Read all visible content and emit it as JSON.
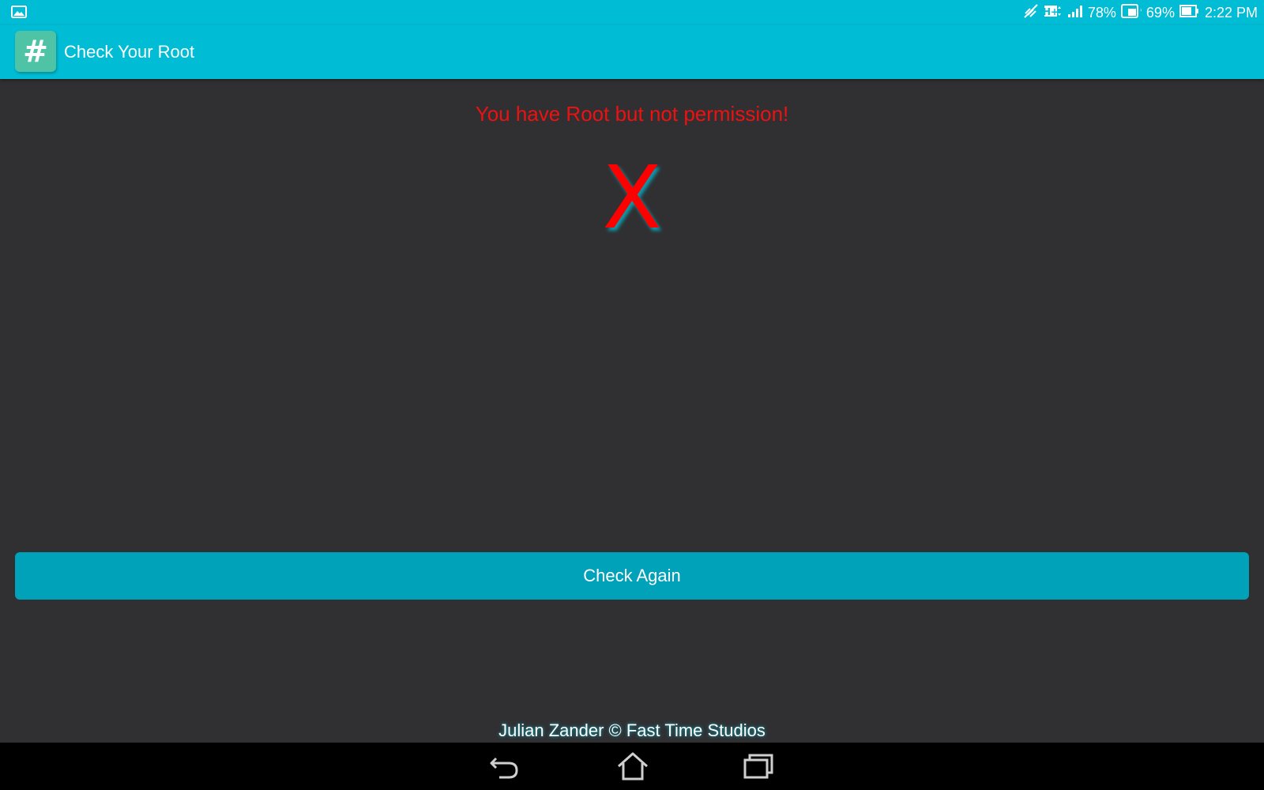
{
  "status_bar": {
    "left_icon": "gallery-notification-icon",
    "icons": [
      "mute-icon",
      "hplus-data-icon",
      "signal-icon",
      "tablet-battery-icon",
      "battery-icon"
    ],
    "signal_percent": "78%",
    "battery_percent": "69%",
    "time": "2:22 PM"
  },
  "app_bar": {
    "icon_glyph": "#",
    "title": "Check Your Root"
  },
  "main": {
    "message": "You have Root but not permission!",
    "message_color": "#ee1111",
    "result_mark": "X",
    "check_again_label": "Check Again",
    "accent_color": "#00bcd4"
  },
  "footer": {
    "credit": "Julian Zander © Fast Time Studios"
  },
  "nav_bar": {
    "buttons": [
      "back-icon",
      "home-icon",
      "recent-apps-icon"
    ]
  }
}
